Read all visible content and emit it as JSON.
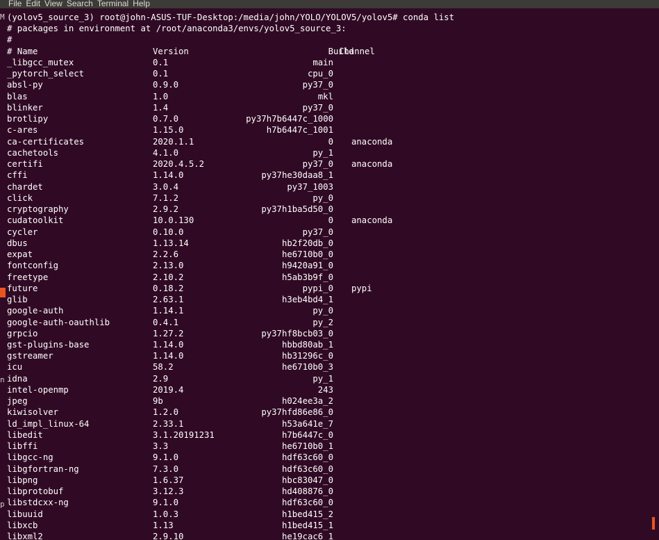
{
  "menu": [
    "File",
    "Edit",
    "View",
    "Search",
    "Terminal",
    "Help"
  ],
  "colors": {
    "background": "#300a24",
    "foreground": "#ffffff",
    "menubar": "#3c3b37",
    "accent": "#e95420"
  },
  "terminal": {
    "prompt": "(yolov5_source_3) root@john-ASUS-TUF-Desktop:/media/john/YOLO/YOLOV5/yolov5# conda list",
    "header_lines": [
      "# packages in environment at /root/anaconda3/envs/yolov5_source_3:",
      "#"
    ],
    "columns": {
      "name": "# Name",
      "version": "Version",
      "build": "Build",
      "channel": "Channel"
    },
    "packages": [
      {
        "name": "_libgcc_mutex",
        "version": "0.1",
        "build": "main",
        "channel": ""
      },
      {
        "name": "_pytorch_select",
        "version": "0.1",
        "build": "cpu_0",
        "channel": ""
      },
      {
        "name": "absl-py",
        "version": "0.9.0",
        "build": "py37_0",
        "channel": ""
      },
      {
        "name": "blas",
        "version": "1.0",
        "build": "mkl",
        "channel": ""
      },
      {
        "name": "blinker",
        "version": "1.4",
        "build": "py37_0",
        "channel": ""
      },
      {
        "name": "brotlipy",
        "version": "0.7.0",
        "build": "py37h7b6447c_1000",
        "channel": ""
      },
      {
        "name": "c-ares",
        "version": "1.15.0",
        "build": "h7b6447c_1001",
        "channel": ""
      },
      {
        "name": "ca-certificates",
        "version": "2020.1.1",
        "build": "0",
        "channel": "anaconda"
      },
      {
        "name": "cachetools",
        "version": "4.1.0",
        "build": "py_1",
        "channel": ""
      },
      {
        "name": "certifi",
        "version": "2020.4.5.2",
        "build": "py37_0",
        "channel": "anaconda"
      },
      {
        "name": "cffi",
        "version": "1.14.0",
        "build": "py37he30daa8_1",
        "channel": ""
      },
      {
        "name": "chardet",
        "version": "3.0.4",
        "build": "py37_1003",
        "channel": ""
      },
      {
        "name": "click",
        "version": "7.1.2",
        "build": "py_0",
        "channel": ""
      },
      {
        "name": "cryptography",
        "version": "2.9.2",
        "build": "py37h1ba5d50_0",
        "channel": ""
      },
      {
        "name": "cudatoolkit",
        "version": "10.0.130",
        "build": "0",
        "channel": "anaconda"
      },
      {
        "name": "cycler",
        "version": "0.10.0",
        "build": "py37_0",
        "channel": ""
      },
      {
        "name": "dbus",
        "version": "1.13.14",
        "build": "hb2f20db_0",
        "channel": ""
      },
      {
        "name": "expat",
        "version": "2.2.6",
        "build": "he6710b0_0",
        "channel": ""
      },
      {
        "name": "fontconfig",
        "version": "2.13.0",
        "build": "h9420a91_0",
        "channel": ""
      },
      {
        "name": "freetype",
        "version": "2.10.2",
        "build": "h5ab3b9f_0",
        "channel": ""
      },
      {
        "name": "future",
        "version": "0.18.2",
        "build": "pypi_0",
        "channel": "pypi"
      },
      {
        "name": "glib",
        "version": "2.63.1",
        "build": "h3eb4bd4_1",
        "channel": ""
      },
      {
        "name": "google-auth",
        "version": "1.14.1",
        "build": "py_0",
        "channel": ""
      },
      {
        "name": "google-auth-oauthlib",
        "version": "0.4.1",
        "build": "py_2",
        "channel": ""
      },
      {
        "name": "grpcio",
        "version": "1.27.2",
        "build": "py37hf8bcb03_0",
        "channel": ""
      },
      {
        "name": "gst-plugins-base",
        "version": "1.14.0",
        "build": "hbbd80ab_1",
        "channel": ""
      },
      {
        "name": "gstreamer",
        "version": "1.14.0",
        "build": "hb31296c_0",
        "channel": ""
      },
      {
        "name": "icu",
        "version": "58.2",
        "build": "he6710b0_3",
        "channel": ""
      },
      {
        "name": "idna",
        "version": "2.9",
        "build": "py_1",
        "channel": ""
      },
      {
        "name": "intel-openmp",
        "version": "2019.4",
        "build": "243",
        "channel": ""
      },
      {
        "name": "jpeg",
        "version": "9b",
        "build": "h024ee3a_2",
        "channel": ""
      },
      {
        "name": "kiwisolver",
        "version": "1.2.0",
        "build": "py37hfd86e86_0",
        "channel": ""
      },
      {
        "name": "ld_impl_linux-64",
        "version": "2.33.1",
        "build": "h53a641e_7",
        "channel": ""
      },
      {
        "name": "libedit",
        "version": "3.1.20191231",
        "build": "h7b6447c_0",
        "channel": ""
      },
      {
        "name": "libffi",
        "version": "3.3",
        "build": "he6710b0_1",
        "channel": ""
      },
      {
        "name": "libgcc-ng",
        "version": "9.1.0",
        "build": "hdf63c60_0",
        "channel": ""
      },
      {
        "name": "libgfortran-ng",
        "version": "7.3.0",
        "build": "hdf63c60_0",
        "channel": ""
      },
      {
        "name": "libpng",
        "version": "1.6.37",
        "build": "hbc83047_0",
        "channel": ""
      },
      {
        "name": "libprotobuf",
        "version": "3.12.3",
        "build": "hd408876_0",
        "channel": ""
      },
      {
        "name": "libstdcxx-ng",
        "version": "9.1.0",
        "build": "hdf63c60_0",
        "channel": ""
      },
      {
        "name": "libuuid",
        "version": "1.0.3",
        "build": "h1bed415_2",
        "channel": ""
      },
      {
        "name": "libxcb",
        "version": "1.13",
        "build": "h1bed415_1",
        "channel": ""
      },
      {
        "name": "libxml2",
        "version": "2.9.10",
        "build": "he19cac6_1",
        "channel": ""
      }
    ]
  }
}
